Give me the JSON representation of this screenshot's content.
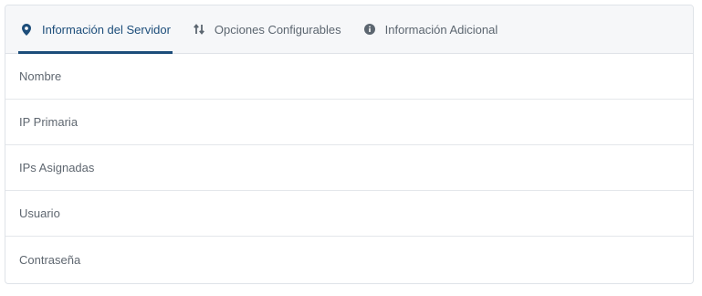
{
  "tabs": [
    {
      "label": "Información del Servidor",
      "icon": "map-marker-icon",
      "active": true
    },
    {
      "label": "Opciones Configurables",
      "icon": "sort-arrows-icon",
      "active": false
    },
    {
      "label": "Información Adicional",
      "icon": "info-circle-icon",
      "active": false
    }
  ],
  "rows": [
    {
      "label": "Nombre",
      "value": ""
    },
    {
      "label": "IP Primaria",
      "value": ""
    },
    {
      "label": "IPs Asignadas",
      "value": ""
    },
    {
      "label": "Usuario",
      "value": ""
    },
    {
      "label": "Contraseña",
      "value": ""
    }
  ],
  "colors": {
    "accent": "#1c4d7a",
    "tab_bar_bg": "#f6f7f9",
    "text_muted": "#5f6770",
    "border": "#dfe3e8"
  }
}
